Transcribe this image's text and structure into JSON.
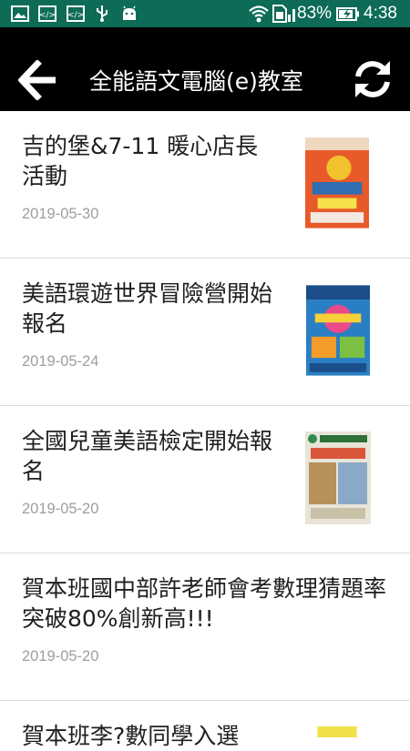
{
  "status_bar": {
    "battery_percent": "83%",
    "time": "4:38",
    "colors": {
      "background": "#0d6b57"
    },
    "icons": [
      "image-icon",
      "code-icon",
      "code-icon",
      "usb-icon",
      "android-icon",
      "wifi-icon",
      "sim-icon",
      "signal-icon",
      "battery-charging-icon"
    ]
  },
  "app_bar": {
    "title": "全能語文電腦(e)教室",
    "back_icon": "arrow-left-icon",
    "refresh_icon": "refresh-icon",
    "colors": {
      "background": "#000000",
      "foreground": "#ffffff"
    }
  },
  "news": [
    {
      "title": "吉的堡&7-11 暖心店長活動",
      "date": "2019-05-30",
      "thumbnail": "poster-thumbnail"
    },
    {
      "title": "美語環遊世界冒險營開始報名",
      "date": "2019-05-24",
      "thumbnail": "poster-thumbnail"
    },
    {
      "title": "全國兒童美語檢定開始報名",
      "date": "2019-05-20",
      "thumbnail": "poster-thumbnail"
    },
    {
      "title": "賀本班國中部許老師會考數理猜題率突破80%創新高!!!",
      "date": "2019-05-20"
    },
    {
      "title": "賀本班李?數同學入選",
      "thumbnail": "poster-thumbnail"
    }
  ]
}
